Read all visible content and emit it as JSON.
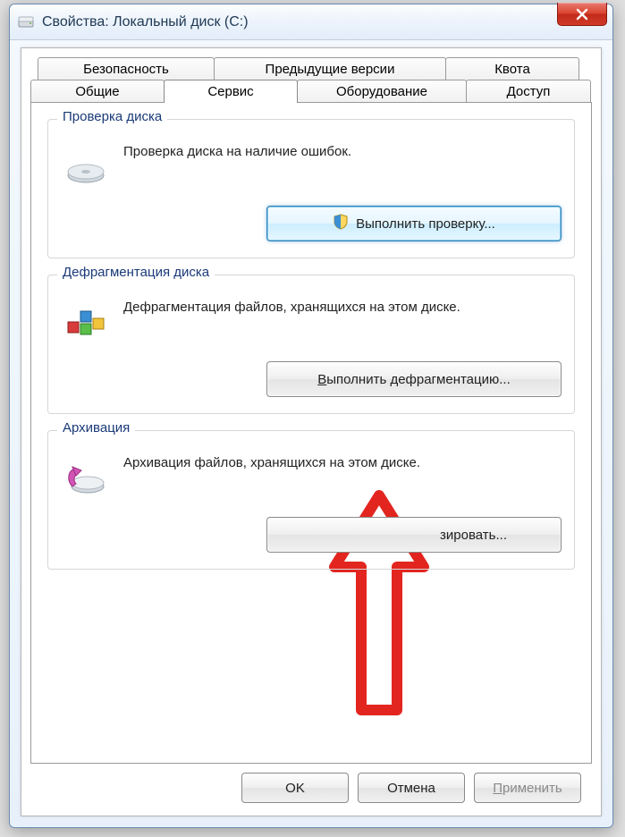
{
  "window": {
    "title": "Свойства: Локальный диск (C:)"
  },
  "tabs": {
    "security": "Безопасность",
    "previous_versions": "Предыдущие версии",
    "quota": "Квота",
    "general": "Общие",
    "service": "Сервис",
    "hardware": "Оборудование",
    "sharing": "Доступ"
  },
  "groups": {
    "check": {
      "title": "Проверка диска",
      "text": "Проверка диска на наличие ошибок.",
      "button": "Выполнить проверку..."
    },
    "defrag": {
      "title": "Дефрагментация диска",
      "text": "Дефрагментация файлов, хранящихся на этом диске.",
      "button": "Выполнить дефрагментацию..."
    },
    "backup": {
      "title": "Архивация",
      "text": "Архивация файлов, хранящихся на этом диске.",
      "button_suffix": "зировать..."
    }
  },
  "footer": {
    "ok": "OK",
    "cancel": "Отмена",
    "apply": "Применить"
  }
}
